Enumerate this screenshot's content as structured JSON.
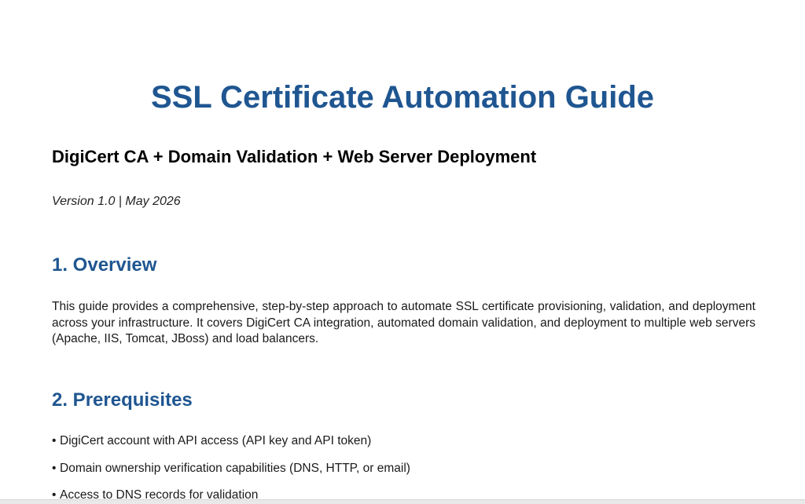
{
  "document": {
    "title": "SSL Certificate Automation Guide",
    "subtitle": "DigiCert CA + Domain Validation + Web Server Deployment",
    "version_line": "Version 1.0 | May 2026"
  },
  "sections": {
    "overview": {
      "heading": "1. Overview",
      "body": "This guide provides a comprehensive, step-by-step approach to automate SSL certificate provisioning, validation, and deployment across your infrastructure. It covers DigiCert CA integration, automated domain validation, and deployment to multiple web servers (Apache, IIS, Tomcat, JBoss) and load balancers."
    },
    "prerequisites": {
      "heading": "2. Prerequisites",
      "bullet_glyph": "•",
      "items": [
        "DigiCert account with API access (API key and API token)",
        "Domain ownership verification capabilities (DNS, HTTP, or email)",
        "Access to DNS records for validation"
      ]
    }
  }
}
